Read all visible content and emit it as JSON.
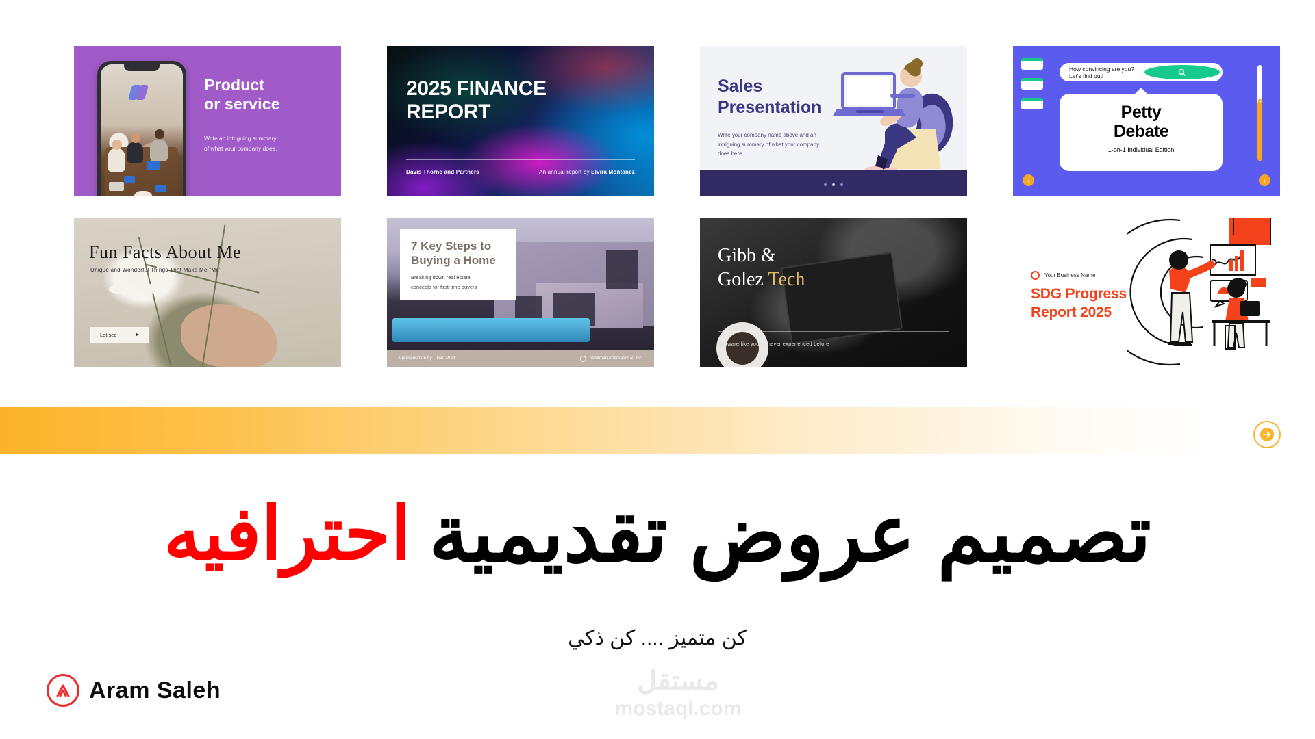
{
  "cards": [
    {
      "id": "product-or-service",
      "title_line1": "Product",
      "title_line2": "or service",
      "body_line1": "Write an intriguing summary",
      "body_line2": "of what your company does.",
      "bg_color": "#a05bc8"
    },
    {
      "id": "finance-report",
      "title_line1": "2025 FINANCE",
      "title_line2": "REPORT",
      "footer_left": "Davis Thorne and Partners",
      "footer_right_prefix": "An annual report by ",
      "footer_right_author": "Elvira Montanez"
    },
    {
      "id": "sales-presentation",
      "title_line1": "Sales",
      "title_line2": "Presentation",
      "body_line1": "Write your company name above and an intriguing",
      "body_line2": "summary of what your company does here.",
      "accent_color": "#3b3782",
      "band_color": "#322a63"
    },
    {
      "id": "petty-debate",
      "search_text": "How convincing are you? Let's find out!",
      "title_line1": "Petty",
      "title_line2": "Debate",
      "subtitle": "1-on-1 Individual Edition",
      "bg_color": "#5b5bf0",
      "accent_color": "#16c98d",
      "slider_color": "#f6a623",
      "nav_prev": "‹",
      "nav_next": "›"
    },
    {
      "id": "fun-facts",
      "title": "Fun Facts About Me",
      "subtitle": "Unique and Wonderful Things That Make Me \"Me\"",
      "button_label": "Let see"
    },
    {
      "id": "buying-a-home",
      "title_line1": "7 Key Steps to",
      "title_line2": "Buying a Home",
      "body_line1": "Breaking down real estate",
      "body_line2": "concepts for first-time buyers",
      "footer_left": "A presentation by Lillian Pratt",
      "footer_right": "Whitman International, Inc."
    },
    {
      "id": "gibb-golez-tech",
      "title_line1": "Gibb &",
      "title_line2_plain": "Golez ",
      "title_line2_accent": "Tech",
      "tagline": "Software like you've never experienced before",
      "accent_color": "#e0b86a"
    },
    {
      "id": "sdg-progress-report",
      "business_name": "Your Business Name",
      "title_line1": "SDG Progress",
      "title_line2": "Report 2025",
      "accent_color": "#f4421a"
    }
  ],
  "band": {
    "arrow_icon": "arrow-right",
    "gradient_start": "#fcb32a",
    "gradient_end": "#ffffff",
    "arrow_color": "#fbb52c"
  },
  "headline": {
    "black_text": "تصميم عروض تقديمية",
    "red_text": "احترافيه",
    "black_color": "#000000",
    "red_color": "#ff0000"
  },
  "subtitle": "كن متميز .... كن ذكي",
  "brand": {
    "name": "Aram  Saleh",
    "logo_color": "#ef2a2a"
  },
  "watermark": {
    "arabic": "مستقل",
    "latin": "mostaql.com"
  }
}
